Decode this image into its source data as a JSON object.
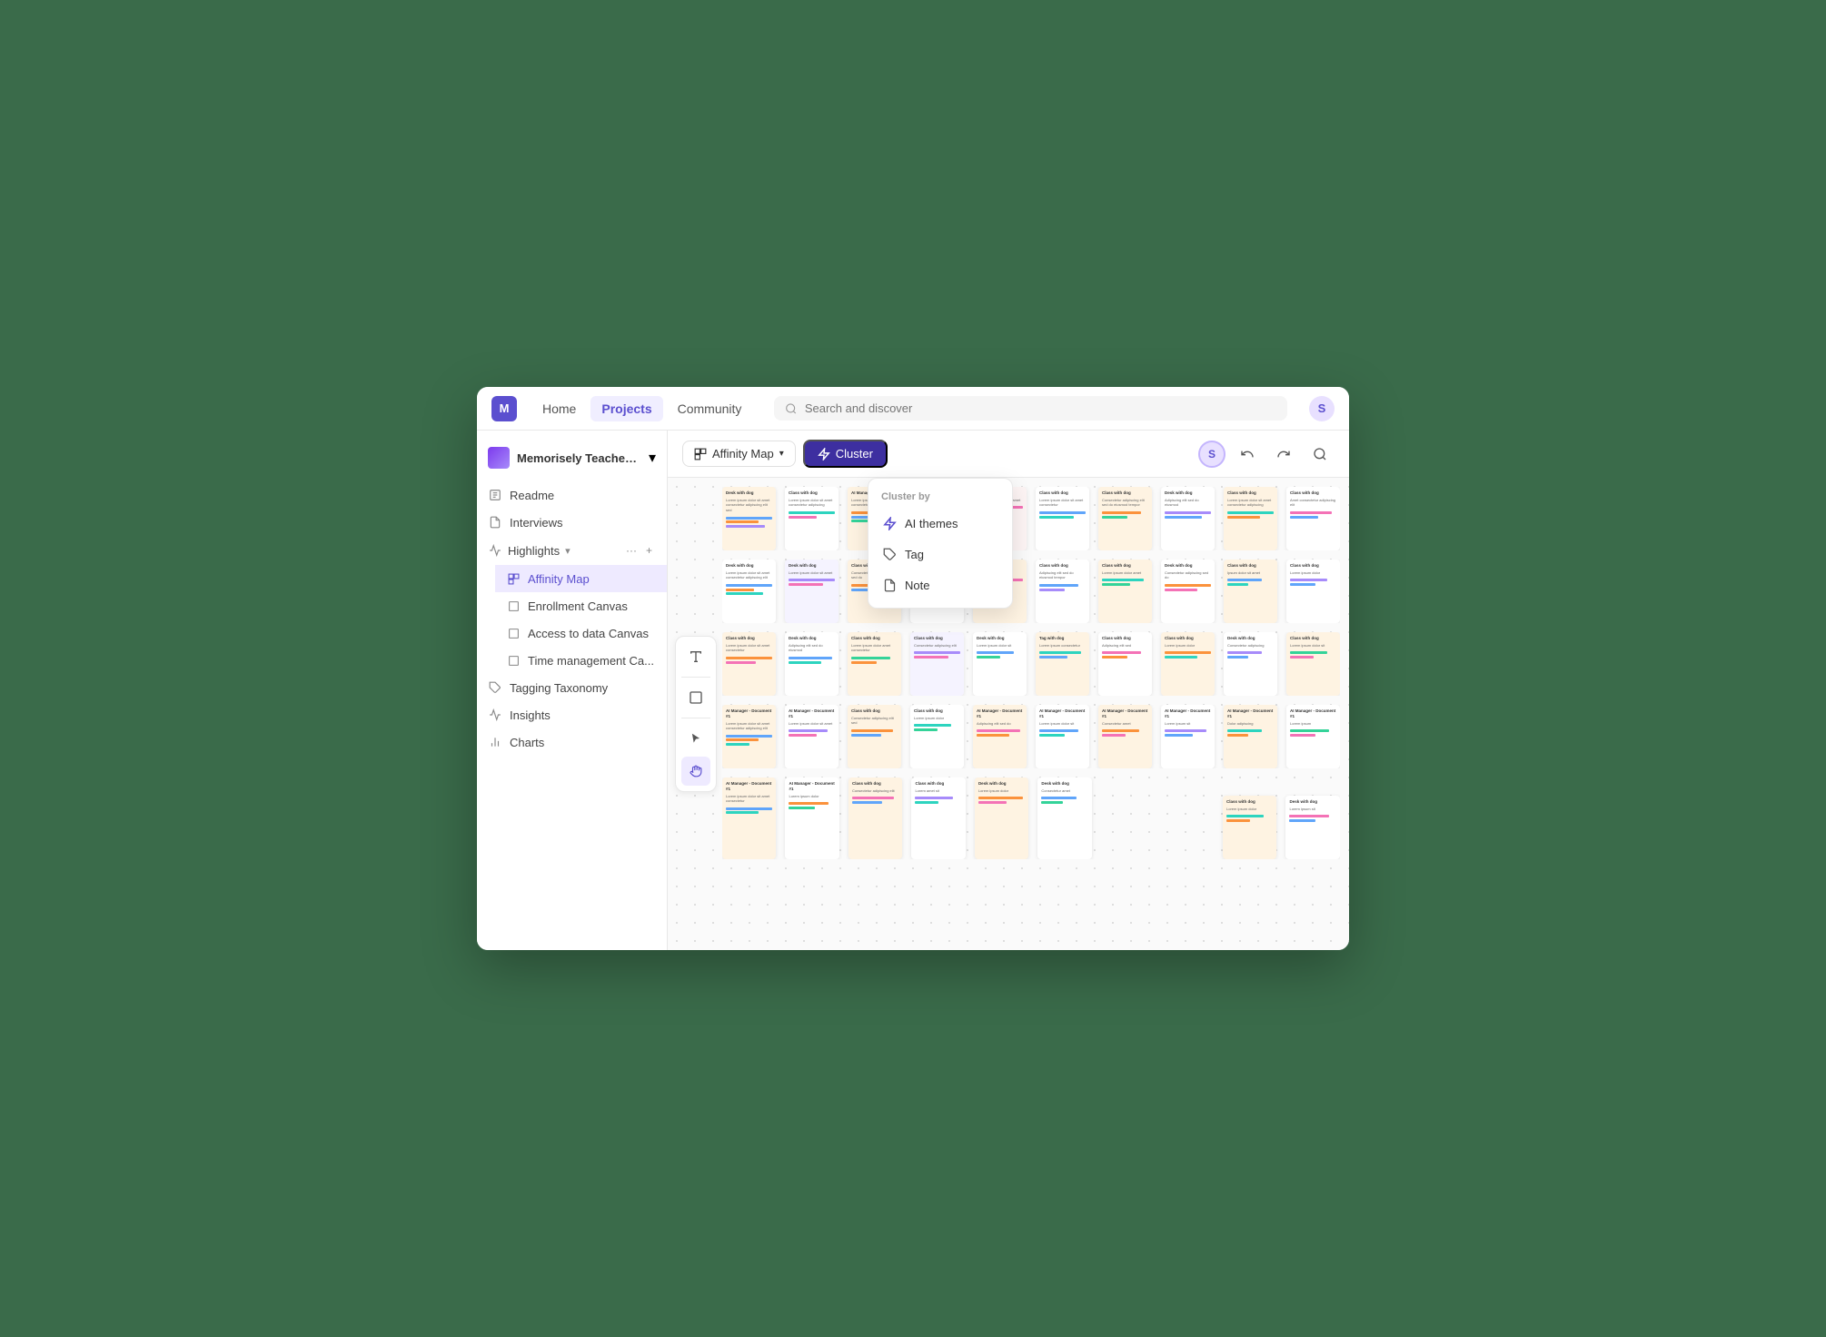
{
  "topNav": {
    "logo": "M",
    "links": [
      {
        "label": "Home",
        "active": false
      },
      {
        "label": "Projects",
        "active": true
      },
      {
        "label": "Community",
        "active": false
      }
    ],
    "search": {
      "placeholder": "Search and discover"
    },
    "user": {
      "initials": "S"
    }
  },
  "sidebar": {
    "workspace": {
      "name": "Memorisely Teacher ...",
      "chevron": "▾"
    },
    "items": [
      {
        "label": "Readme",
        "icon": "readme"
      },
      {
        "label": "Interviews",
        "icon": "interviews"
      }
    ],
    "sections": [
      {
        "label": "Highlights",
        "icon": "highlights",
        "expanded": true,
        "subItems": [
          {
            "label": "Affinity Map",
            "active": true
          },
          {
            "label": "Enrollment Canvas"
          },
          {
            "label": "Access to data Canvas"
          },
          {
            "label": "Time management Ca..."
          }
        ]
      }
    ],
    "bottomItems": [
      {
        "label": "Tagging Taxonomy",
        "icon": "tag"
      },
      {
        "label": "Insights",
        "icon": "insights"
      },
      {
        "label": "Charts",
        "icon": "charts"
      }
    ]
  },
  "toolbar": {
    "viewLabel": "Affinity Map",
    "viewChevron": "▾",
    "clusterLabel": "Cluster",
    "undoLabel": "↩",
    "redoLabel": "↪",
    "searchLabel": "🔍",
    "userInitials": "S"
  },
  "dropdown": {
    "header": "Cluster by",
    "items": [
      {
        "label": "AI themes",
        "icon": "ai"
      },
      {
        "label": "Tag",
        "icon": "tag"
      },
      {
        "label": "Note",
        "icon": "note"
      }
    ]
  },
  "tools": [
    {
      "icon": "≡",
      "label": "text-tool",
      "active": false
    },
    {
      "icon": "□",
      "label": "shape-tool",
      "active": false
    },
    {
      "icon": "▷",
      "label": "select-tool",
      "active": false
    },
    {
      "icon": "✋",
      "label": "hand-tool",
      "active": true
    }
  ]
}
